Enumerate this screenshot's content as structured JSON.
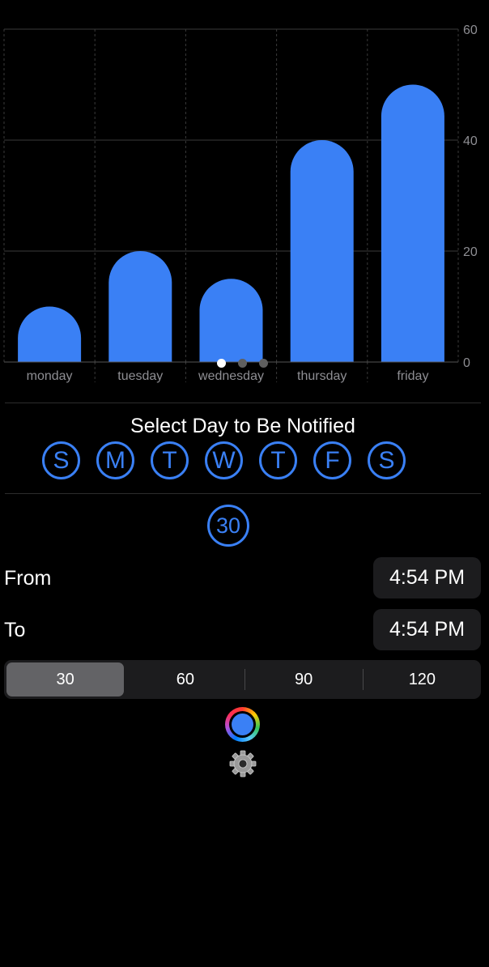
{
  "chart_data": {
    "type": "bar",
    "categories": [
      "monday",
      "tuesday",
      "wednesday",
      "thursday",
      "friday"
    ],
    "values": [
      10,
      20,
      15,
      40,
      50
    ],
    "ylim": [
      0,
      60
    ],
    "yticks": [
      "0",
      "20",
      "40",
      "60"
    ],
    "color": "#3a80f5",
    "grid": true,
    "y_axis_side": "right"
  },
  "pager": {
    "pages": 3,
    "current": 1
  },
  "notify": {
    "title": "Select Day to Be Notified",
    "days": [
      "S",
      "M",
      "T",
      "W",
      "T",
      "F",
      "S"
    ]
  },
  "interval_badge": "30",
  "from": {
    "label": "From",
    "time": "4:54 PM"
  },
  "to": {
    "label": "To",
    "time": "4:54 PM"
  },
  "segments": {
    "options": [
      "30",
      "60",
      "90",
      "120"
    ],
    "selected": "30"
  },
  "accent_color": "#3a80f5",
  "icons": {
    "color_picker": "color-wheel-icon",
    "settings": "gear-icon"
  }
}
